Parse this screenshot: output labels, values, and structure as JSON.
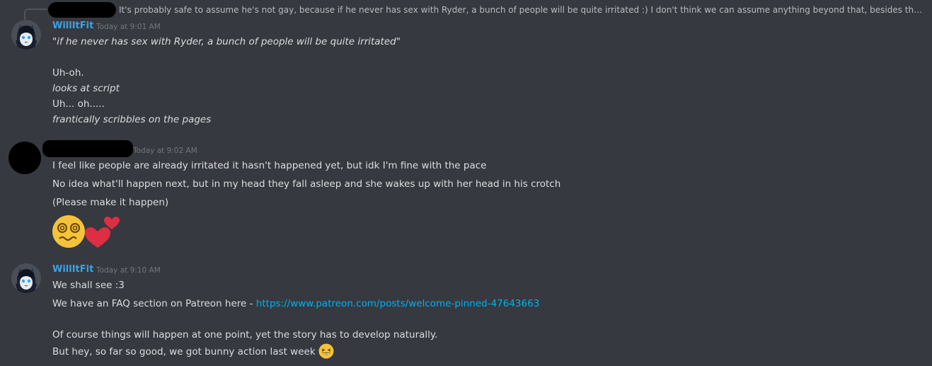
{
  "reply": {
    "text": "It's probably safe to assume he's not gay, because if he never has sex with Ryder, a bunch of people will be quite irritated :) I don't think we can assume anything beyond that, besides the general r..."
  },
  "messages": [
    {
      "username": "WillItFit",
      "timestamp": "Today at 9:01 AM",
      "lines": [
        "\"if he never has sex with Ryder, a bunch of people will be quite irritated\"",
        "Uh-oh.",
        "looks at script",
        "Uh... oh.....",
        "frantically scribbles on the pages"
      ]
    },
    {
      "timestamp": "Today at 9:02 AM",
      "lines": [
        "I feel like people are already irritated it hasn't happened yet, but idk I'm fine with the pace",
        "No idea what'll happen next, but in my head they fall asleep and she wakes up with her head in his crotch",
        "(Please make it happen)"
      ],
      "emojis": [
        "woozy-face-emoji",
        "two-hearts-emoji"
      ]
    },
    {
      "username": "WillItFit",
      "timestamp": "Today at 9:10 AM",
      "lines": [
        "We shall see :3",
        "We have an FAQ section on Patreon here - ",
        "Of course things will happen at one point, yet the story has to develop naturally.",
        "But hey, so far so good, we got bunny action last week"
      ],
      "link": "https://www.patreon.com/posts/welcome-pinned-47643663",
      "emojis": [
        "grinning-squinting-emoji"
      ]
    }
  ],
  "colors": {
    "background": "#36393f",
    "username": "#3ba3e6",
    "link": "#00b0f4",
    "text": "#dcddde",
    "muted": "#72767d"
  }
}
